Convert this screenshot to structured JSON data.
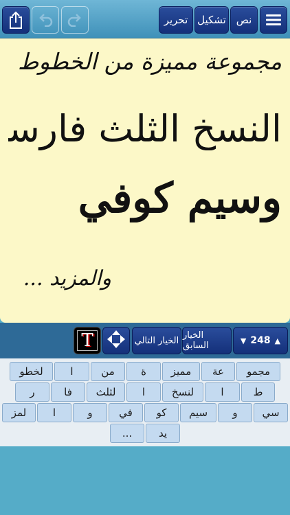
{
  "toolbar": {
    "menu_icon": "hamburger-menu-icon",
    "text_label": "نص",
    "diacritics_label": "تشكيل",
    "edit_label": "تحرير",
    "redo_icon": "redo-icon",
    "undo_icon": "undo-icon",
    "share_icon": "share-export-icon"
  },
  "canvas": {
    "line1": "مجموعة مميزة من الخطوط",
    "line2": "النسخ الثلث فارسي",
    "line3": "وسيم كوفي",
    "line4": "والمزيد ..."
  },
  "controls": {
    "count": "248",
    "previous_label": "الخيار السابق",
    "next_label": "الخيار التالي",
    "move_icon": "move-arrows-icon",
    "font_icon": "font-style-icon",
    "font_glyph": "T"
  },
  "keyboard": {
    "rows": [
      [
        "مجمو",
        "عة",
        "مميز",
        "ة",
        "من",
        "ا",
        "لخطو"
      ],
      [
        "ط",
        "ا",
        "لنسخ",
        "ا",
        "لثلث",
        "فا",
        "ر"
      ],
      [
        "سي",
        "و",
        "سيم",
        "كو",
        "في",
        "و",
        "ا",
        "لمز"
      ],
      [
        "يد",
        "..."
      ]
    ]
  },
  "colors": {
    "canvas_bg": "#fcf8c8",
    "button_blue": "#1f3f8e",
    "key_bg": "#c4daf0",
    "app_bg": "#55acc8"
  }
}
